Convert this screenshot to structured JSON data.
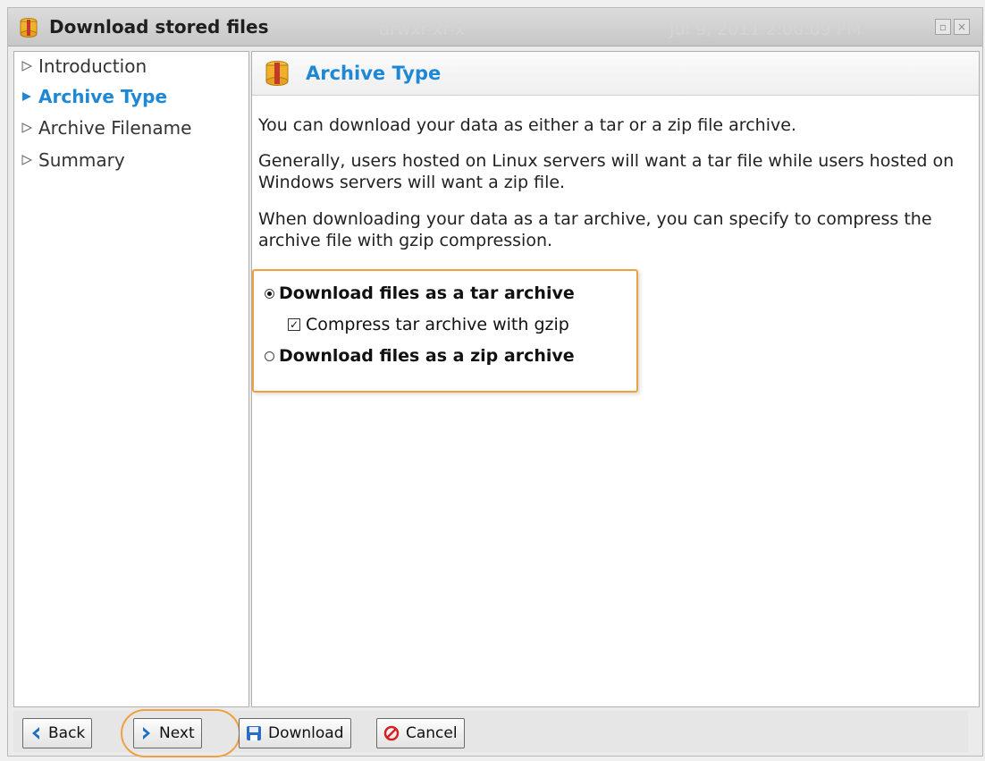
{
  "window": {
    "title": "Download stored files",
    "background_listing": {
      "permissions": "drwxr-xr-x",
      "date": "Jul 9, 2011 2:00:09 PM"
    }
  },
  "sidebar": {
    "items": [
      {
        "label": "Introduction",
        "active": false
      },
      {
        "label": "Archive Type",
        "active": true
      },
      {
        "label": "Archive Filename",
        "active": false
      },
      {
        "label": "Summary",
        "active": false
      }
    ]
  },
  "content": {
    "title": "Archive Type",
    "paragraphs": [
      "You can download your data as either a tar or a zip file archive.",
      "Generally, users hosted on Linux servers will want a tar file while users hosted on Windows servers will want a zip file.",
      "When downloading your data as a tar archive, you can specify to compress the archive file with gzip compression."
    ],
    "options": {
      "tar_label": "Download files as a tar archive",
      "tar_selected": true,
      "gzip_label": "Compress tar archive with gzip",
      "gzip_checked": true,
      "zip_label": "Download files as a zip archive",
      "zip_selected": false
    }
  },
  "footer": {
    "back_label": "Back",
    "next_label": "Next",
    "download_label": "Download",
    "cancel_label": "Cancel"
  },
  "colors": {
    "accent": "#1e88d4",
    "highlight": "#f0a040",
    "cancel_red": "#d42020"
  }
}
